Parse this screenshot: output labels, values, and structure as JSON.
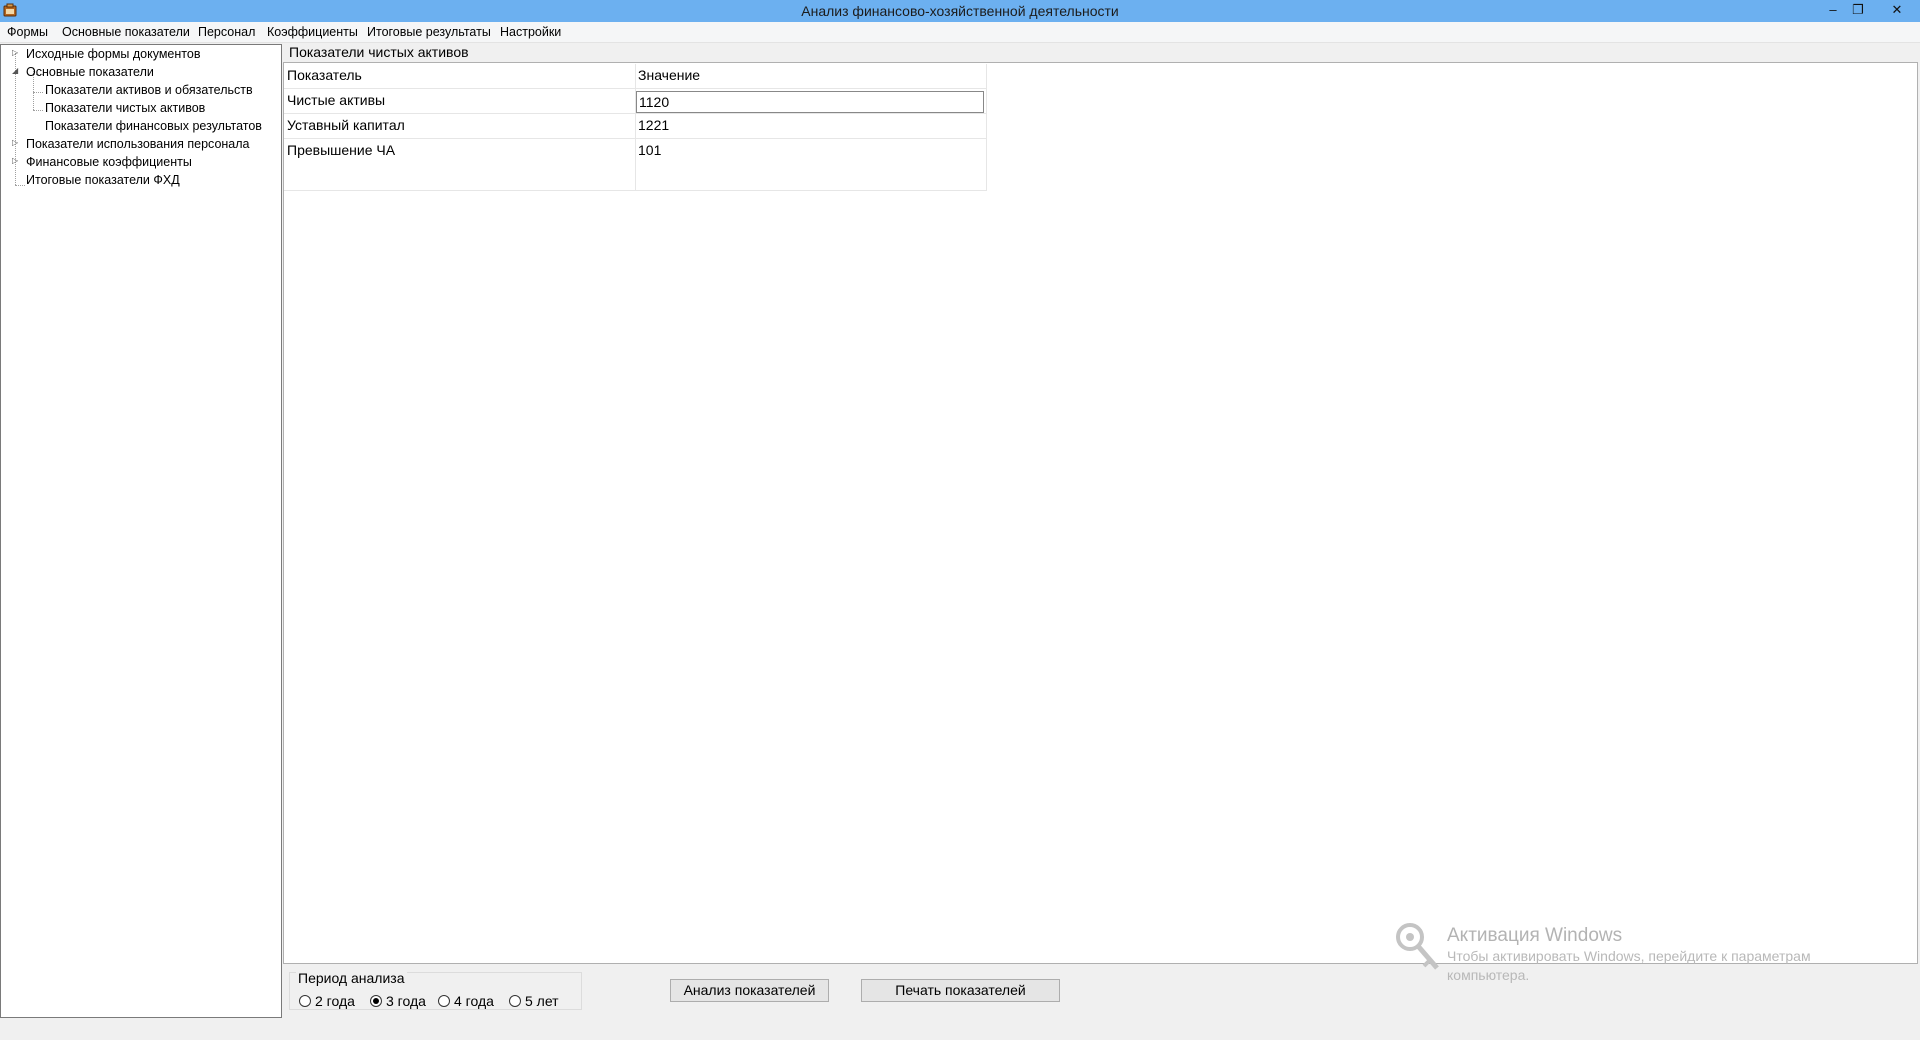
{
  "window": {
    "title": "Анализ финансово-хозяйственной деятельности",
    "minimize_glyph": "–",
    "restore_glyph": "❐",
    "close_glyph": "✕"
  },
  "menu": {
    "items": [
      "Формы",
      "Основные показатели",
      "Персонал",
      "Коэффициенты",
      "Итоговые результаты",
      "Настройки"
    ]
  },
  "tree": {
    "nodes": [
      {
        "label": "Исходные формы документов",
        "level": 0,
        "toggle": "▷"
      },
      {
        "label": "Основные показатели",
        "level": 0,
        "toggle": "◢"
      },
      {
        "label": "Показатели активов и обязательств",
        "level": 1
      },
      {
        "label": "Показатели чистых активов",
        "level": 1
      },
      {
        "label": "Показатели финансовых результатов",
        "level": 1
      },
      {
        "label": "Показатели  использования персонала",
        "level": 0,
        "toggle": "▷"
      },
      {
        "label": "Финансовые коэффициенты",
        "level": 0,
        "toggle": "▷"
      },
      {
        "label": "Итоговые показатели ФХД",
        "level": 0
      }
    ]
  },
  "main": {
    "group_title": "Показатели чистых активов",
    "grid": {
      "columns": [
        "Показатель",
        "Значение"
      ],
      "rows": [
        [
          "Чистые активы",
          "1120"
        ],
        [
          "Уставный капитал",
          "1221"
        ],
        [
          "Превышение ЧА",
          "101"
        ]
      ]
    }
  },
  "bottom": {
    "period_label": "Период анализа",
    "period_options": [
      "2 года",
      "3 года",
      "4 года",
      "5 лет"
    ],
    "period_selected": "3 года",
    "analyze_button": "Анализ показателей",
    "print_button": "Печать показателей"
  },
  "watermark": {
    "title": "Активация Windows",
    "line1": "Чтобы активировать Windows, перейдите к параметрам",
    "line2": "компьютера."
  },
  "colors": {
    "titlebar": "#6cb0f0",
    "panel_bg": "#f0f0f0",
    "content_bg": "#ffffff"
  }
}
